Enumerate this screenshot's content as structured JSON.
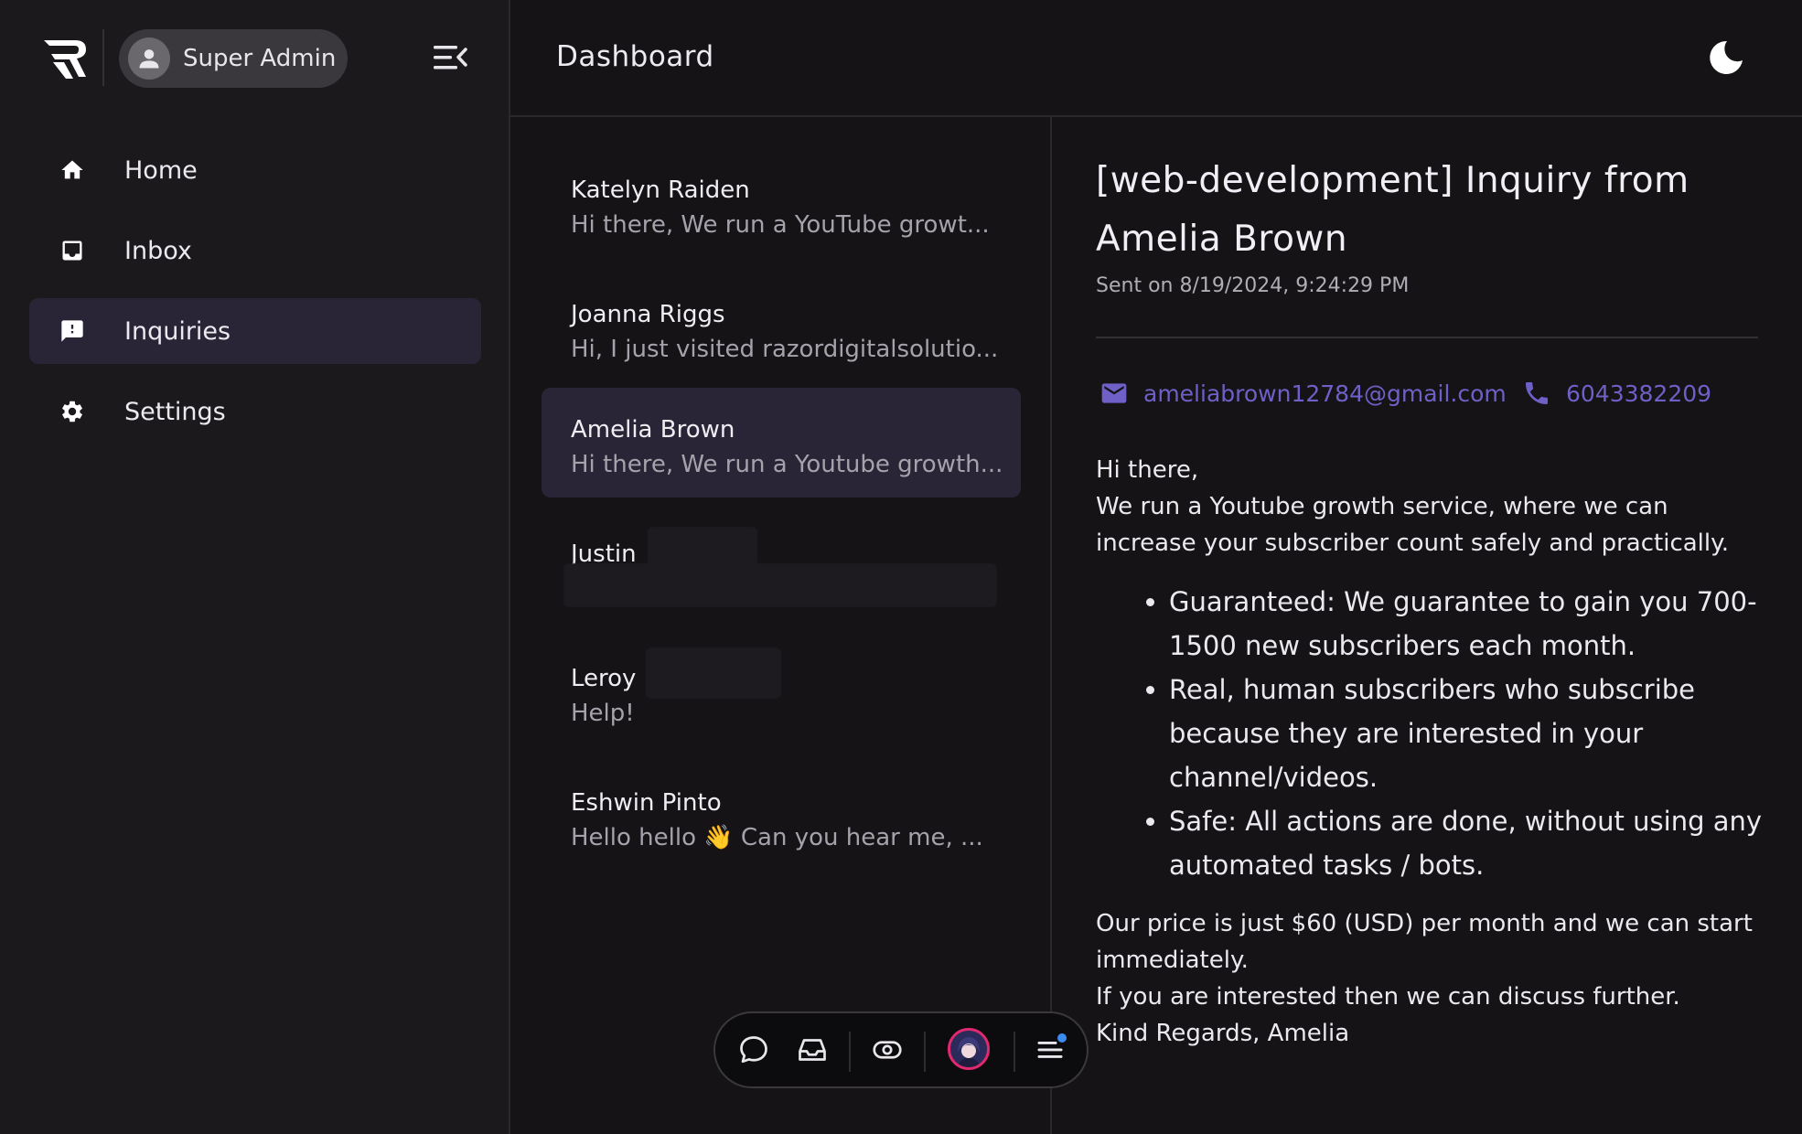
{
  "user": {
    "name": "Super Admin"
  },
  "sidebar": {
    "items": [
      {
        "label": "Home",
        "icon": "home-icon",
        "active": false
      },
      {
        "label": "Inbox",
        "icon": "inbox-icon",
        "active": false
      },
      {
        "label": "Inquiries",
        "icon": "feedback-icon",
        "active": true
      },
      {
        "label": "Settings",
        "icon": "gear-icon",
        "active": false
      }
    ]
  },
  "header": {
    "title": "Dashboard"
  },
  "inquiries": [
    {
      "name": "Katelyn Raiden",
      "snippet": "Hi there, We run a YouTube growt..."
    },
    {
      "name": "Joanna Riggs",
      "snippet": "Hi, I just visited razordigitalsolutio..."
    },
    {
      "name": "Amelia Brown",
      "snippet": "Hi there, We run a Youtube growth...",
      "selected": true
    },
    {
      "name": "Justin",
      "snippet": ""
    },
    {
      "name": "Leroy",
      "snippet": "Help!"
    },
    {
      "name": "Eshwin Pinto",
      "snippet": "Hello hello 👋 Can you hear me, ..."
    }
  ],
  "detail": {
    "title": "[web-development] Inquiry from Amelia Brown",
    "sent": "Sent on 8/19/2024, 9:24:29 PM",
    "email": "ameliabrown12784@gmail.com",
    "phone": "6043382209",
    "greeting": "Hi there,",
    "intro": "We run a Youtube growth service, where we can increase your subscriber count safely and practically.",
    "bullets": [
      "Guaranteed: We guarantee to gain you 700-1500 new subscribers each month.",
      "Real, human subscribers who subscribe because they are interested in your channel/videos.",
      "Safe: All actions are done, without using any automated tasks / bots."
    ],
    "price": "Our price is just $60 (USD) per month and we can start immediately.",
    "further": "If you are interested then we can discuss further.",
    "signoff": "Kind Regards, Amelia"
  },
  "colors": {
    "accent": "#6e60c6",
    "active_bg": "#2a2536",
    "avatar_ring": "#e0296e",
    "notif_dot": "#3b8cf0"
  }
}
